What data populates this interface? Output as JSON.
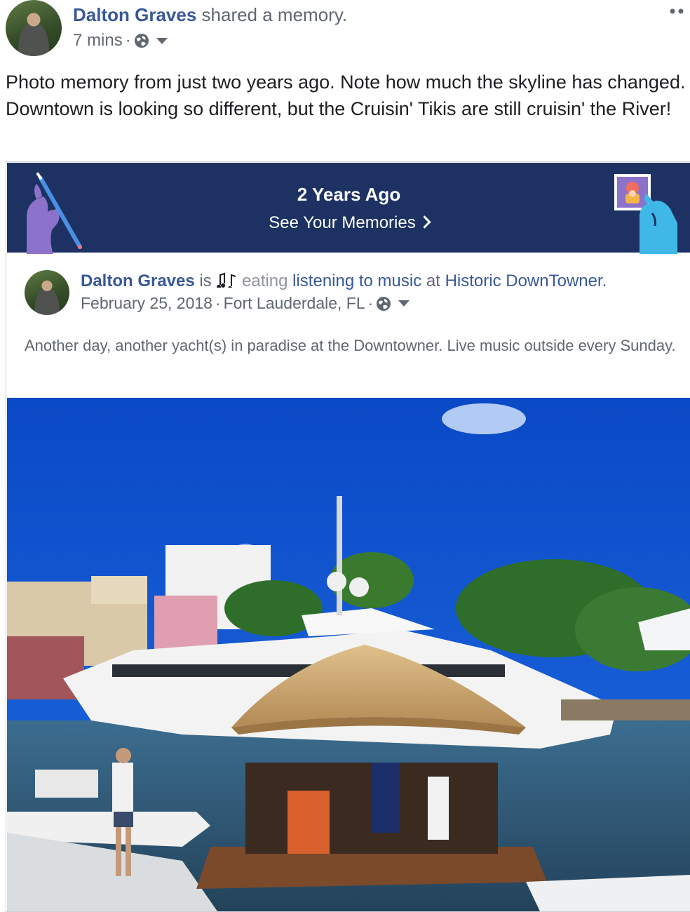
{
  "header": {
    "author": "Dalton Graves",
    "action": " shared a memory.",
    "time": "7 mins",
    "separator": " ·"
  },
  "post": {
    "text": "Photo memory from just two years ago. Note how much the skyline has changed. Downtown is looking so different, but the Cruisin' Tikis are still cruisin' the River!"
  },
  "memory_banner": {
    "title": "2 Years Ago",
    "link_label": "See Your Memories",
    "background": "#1d3263"
  },
  "memory_post": {
    "author": "Dalton Graves",
    "is": " is ",
    "verb_struck": "eating",
    "activity": "listening to music",
    "at": " at ",
    "place": "Historic DownTowner.",
    "date": "February 25, 2018",
    "location": "Fort Lauderdale, FL",
    "sep1": " · ",
    "sep2": " ·",
    "text": "Another day, another yacht(s) in paradise at the Downtowner. Live music outside every Sunday."
  },
  "icons": {
    "audience": "globe-icon",
    "menu": "chevron-down-icon",
    "more": "more-dots-icon",
    "music": "music-notes-icon"
  },
  "colors": {
    "link": "#385898",
    "muted": "#606770"
  }
}
